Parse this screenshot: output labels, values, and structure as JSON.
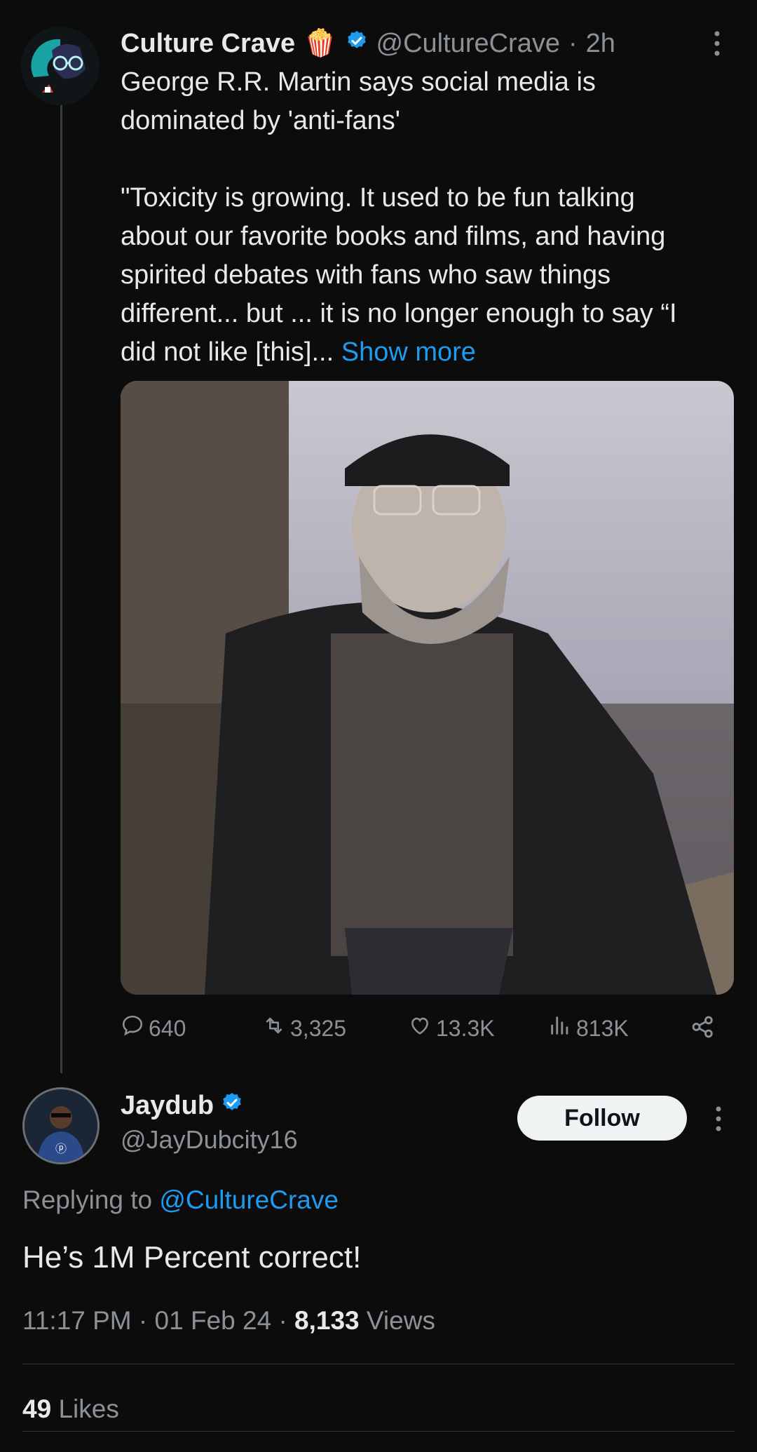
{
  "tweet": {
    "author_name": "Culture Crave",
    "author_emoji": "🍿",
    "author_handle": "@CultureCrave",
    "time_sep": "·",
    "time": "2h",
    "text_line1": "George R.R. Martin says social media is",
    "text_line2": "dominated by 'anti-fans'",
    "quote_line1": "\"Toxicity is growing.  It used to be fun talking",
    "quote_line2": "about our favorite books and films, and having",
    "quote_line3": "spirited debates with fans who saw things",
    "quote_line4": "different... but ... it is no longer enough to say “I",
    "quote_line5": "did not like [this]...",
    "show_more": "Show more",
    "stats": {
      "replies": "640",
      "retweets": "3,325",
      "likes": "13.3K",
      "views": "813K"
    }
  },
  "reply": {
    "author_name": "Jaydub",
    "author_handle": "@JayDubcity16",
    "follow_label": "Follow",
    "replying_prefix": "Replying to",
    "replying_to": "@CultureCrave",
    "text": "He’s 1M Percent correct!",
    "time": "11:17 PM",
    "sep": "·",
    "date": "01 Feb 24",
    "views_count": "8,133",
    "views_label": "Views",
    "likes_count": "49",
    "likes_label": "Likes"
  },
  "icons": [
    "verified-badge-icon",
    "more-icon",
    "reply-icon",
    "retweet-icon",
    "like-icon",
    "views-icon",
    "share-icon"
  ],
  "colors": {
    "background": "#0c0c0c",
    "accent": "#1d9bf0",
    "muted": "#8b9196",
    "text": "#e7e9ea"
  }
}
